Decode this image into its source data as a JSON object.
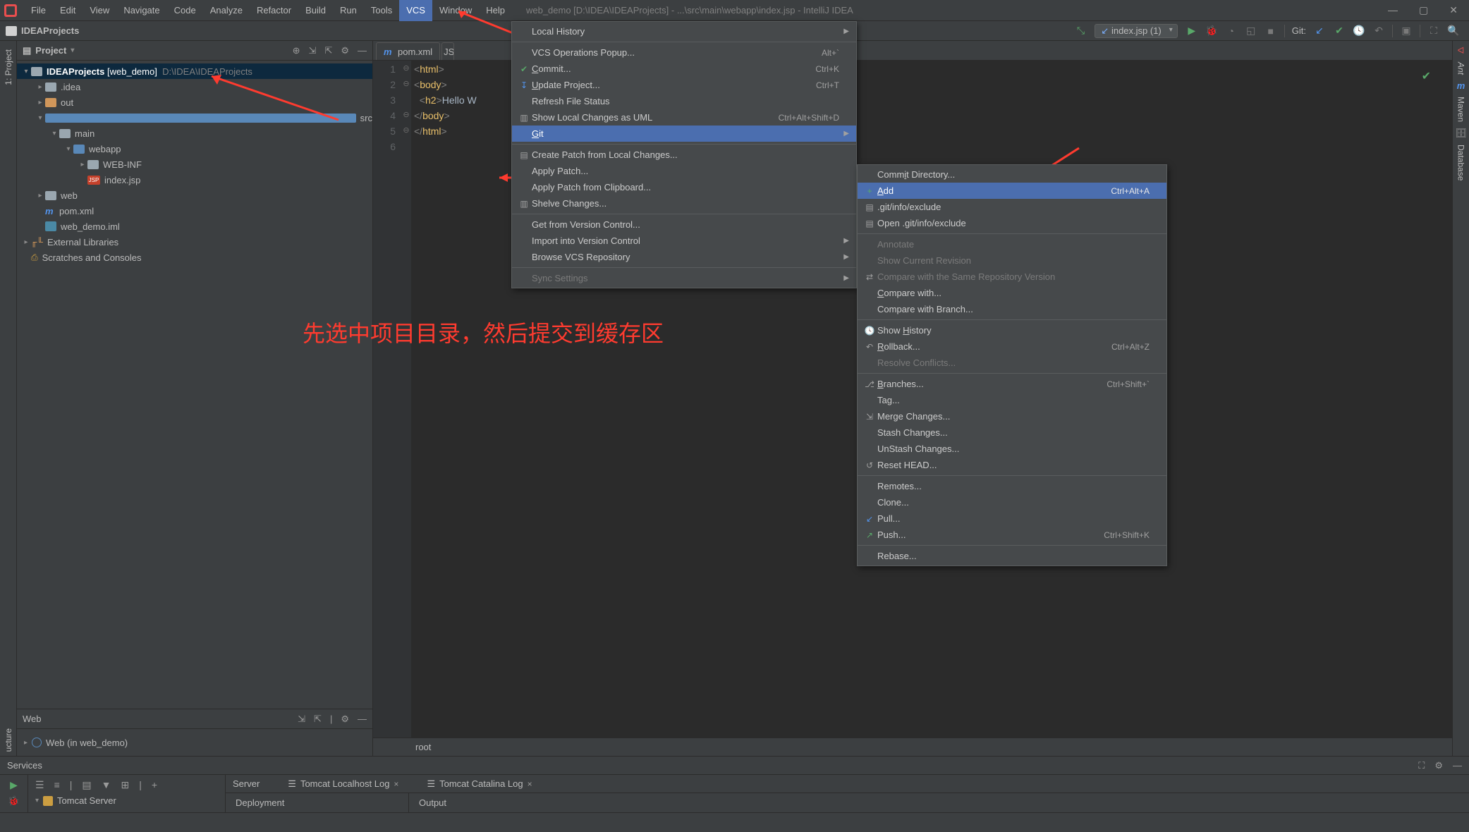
{
  "window_title": "web_demo [D:\\IDEA\\IDEAProjects] - ...\\src\\main\\webapp\\index.jsp - IntelliJ IDEA",
  "menu": {
    "file": "File",
    "edit": "Edit",
    "view": "View",
    "navigate": "Navigate",
    "code": "Code",
    "analyze": "Analyze",
    "refactor": "Refactor",
    "build": "Build",
    "run": "Run",
    "tools": "Tools",
    "vcs": "VCS",
    "window": "Window",
    "help": "Help"
  },
  "breadcrumb": "IDEAProjects",
  "toolbar": {
    "run_config": "index.jsp (1)",
    "git_label": "Git:"
  },
  "side_left": {
    "project": "1: Project",
    "structure": "ucture"
  },
  "side_right": {
    "ant": "Ant",
    "maven": "Maven",
    "database": "Database"
  },
  "project_panel": {
    "title": "Project",
    "root": {
      "name": "IDEAProjects",
      "module": "[web_demo]",
      "path": "D:\\IDEA\\IDEAProjects"
    },
    "tree": [
      {
        "indent": 1,
        "arrow": "▸",
        "icon": "fldr",
        "label": ".idea"
      },
      {
        "indent": 1,
        "arrow": "▸",
        "icon": "fldr out",
        "label": "out"
      },
      {
        "indent": 1,
        "arrow": "▾",
        "icon": "fldr src",
        "label": "src"
      },
      {
        "indent": 2,
        "arrow": "▾",
        "icon": "fldr",
        "label": "main"
      },
      {
        "indent": 3,
        "arrow": "▾",
        "icon": "fldr web",
        "iconprefix": "🌐",
        "label": "webapp"
      },
      {
        "indent": 4,
        "arrow": "▸",
        "icon": "fldr",
        "label": "WEB-INF"
      },
      {
        "indent": 4,
        "arrow": "",
        "icon": "jsp",
        "label": "index.jsp"
      },
      {
        "indent": 1,
        "arrow": "▸",
        "icon": "fldr",
        "label": "web"
      },
      {
        "indent": 1,
        "arrow": "",
        "icon": "m",
        "label": "pom.xml"
      },
      {
        "indent": 1,
        "arrow": "",
        "icon": "iml",
        "label": "web_demo.iml"
      }
    ],
    "ext_lib": "External Libraries",
    "scratch": "Scratches and Consoles"
  },
  "web_panel": {
    "title": "Web",
    "entry": "Web (in web_demo)"
  },
  "editor": {
    "tabs": [
      {
        "icon": "m",
        "label": "pom.xml"
      }
    ],
    "lines": [
      {
        "n": "1",
        "fold": "⊖",
        "html": "<span class='br'>&lt;</span><span class='tag'>html</span><span class='br'>&gt;</span>"
      },
      {
        "n": "2",
        "fold": "⊖",
        "html": "<span class='br'>&lt;</span><span class='tag'>body</span><span class='br'>&gt;</span>"
      },
      {
        "n": "3",
        "fold": "",
        "html": "&nbsp;&nbsp;<span class='br'>&lt;</span><span class='tag'>h2</span><span class='br'>&gt;</span><span class='txt'>Hello W</span>"
      },
      {
        "n": "4",
        "fold": "⊖",
        "html": "<span class='br'>&lt;/</span><span class='tag'>body</span><span class='br'>&gt;</span>"
      },
      {
        "n": "5",
        "fold": "⊖",
        "html": "<span class='br'>&lt;/</span><span class='tag'>html</span><span class='br'>&gt;</span>"
      },
      {
        "n": "6",
        "fold": "",
        "html": ""
      }
    ],
    "breadcrumb": "root"
  },
  "vcs_popup": {
    "items": [
      {
        "label": "Local History",
        "sub": true
      },
      {
        "sep": true
      },
      {
        "label": "VCS Operations Popup...",
        "short": "Alt+`"
      },
      {
        "icon": "✔",
        "iconClass": "g",
        "label": "Commit...",
        "u": "C",
        "short": "Ctrl+K"
      },
      {
        "icon": "↧",
        "iconClass": "b",
        "label": "Update Project...",
        "u": "U",
        "short": "Ctrl+T"
      },
      {
        "label": "Refresh File Status"
      },
      {
        "icon": "▥",
        "label": "Show Local Changes as UML",
        "short": "Ctrl+Alt+Shift+D"
      },
      {
        "label": "Git",
        "u": "G",
        "sub": true,
        "hl": true
      },
      {
        "sep": true
      },
      {
        "icon": "▤",
        "label": "Create Patch from Local Changes..."
      },
      {
        "label": "Apply Patch..."
      },
      {
        "label": "Apply Patch from Clipboard..."
      },
      {
        "icon": "▥",
        "label": "Shelve Changes..."
      },
      {
        "sep": true
      },
      {
        "label": "Get from Version Control..."
      },
      {
        "label": "Import into Version Control",
        "sub": true
      },
      {
        "label": "Browse VCS Repository",
        "sub": true
      },
      {
        "sep": true
      },
      {
        "label": "Sync Settings",
        "disabled": true,
        "sub": true
      }
    ]
  },
  "git_popup": {
    "items": [
      {
        "label": "Commit Directory...",
        "u": "i"
      },
      {
        "icon": "+",
        "iconClass": "g",
        "label": "Add",
        "u": "A",
        "short": "Ctrl+Alt+A",
        "hl": true
      },
      {
        "icon": "▤",
        "label": ".git/info/exclude"
      },
      {
        "icon": "▤",
        "label": "Open .git/info/exclude"
      },
      {
        "sep": true
      },
      {
        "label": "Annotate",
        "disabled": true
      },
      {
        "label": "Show Current Revision",
        "disabled": true
      },
      {
        "icon": "⇄",
        "label": "Compare with the Same Repository Version",
        "disabled": true
      },
      {
        "label": "Compare with...",
        "u": "C"
      },
      {
        "label": "Compare with Branch..."
      },
      {
        "sep": true
      },
      {
        "icon": "🕓",
        "label": "Show History",
        "u": "H"
      },
      {
        "icon": "↶",
        "label": "Rollback...",
        "u": "R",
        "short": "Ctrl+Alt+Z"
      },
      {
        "label": "Resolve Conflicts...",
        "disabled": true
      },
      {
        "sep": true
      },
      {
        "icon": "⎇",
        "label": "Branches...",
        "u": "B",
        "short": "Ctrl+Shift+`"
      },
      {
        "label": "Tag..."
      },
      {
        "icon": "⇲",
        "label": "Merge Changes..."
      },
      {
        "label": "Stash Changes..."
      },
      {
        "label": "UnStash Changes..."
      },
      {
        "icon": "↺",
        "label": "Reset HEAD..."
      },
      {
        "sep": true
      },
      {
        "label": "Remotes..."
      },
      {
        "label": "Clone..."
      },
      {
        "icon": "↙",
        "iconClass": "b",
        "label": "Pull..."
      },
      {
        "icon": "↗",
        "iconClass": "g",
        "label": "Push...",
        "short": "Ctrl+Shift+K"
      },
      {
        "sep": true
      },
      {
        "label": "Rebase..."
      }
    ]
  },
  "annotation": "先选中项目目录，然后提交到缓存区",
  "services": {
    "title": "Services",
    "server_tab": "Server",
    "tomcat_local": "Tomcat Localhost Log",
    "tomcat_catalina": "Tomcat Catalina Log",
    "tomcat_server": "Tomcat Server",
    "deployment": "Deployment",
    "output": "Output"
  }
}
